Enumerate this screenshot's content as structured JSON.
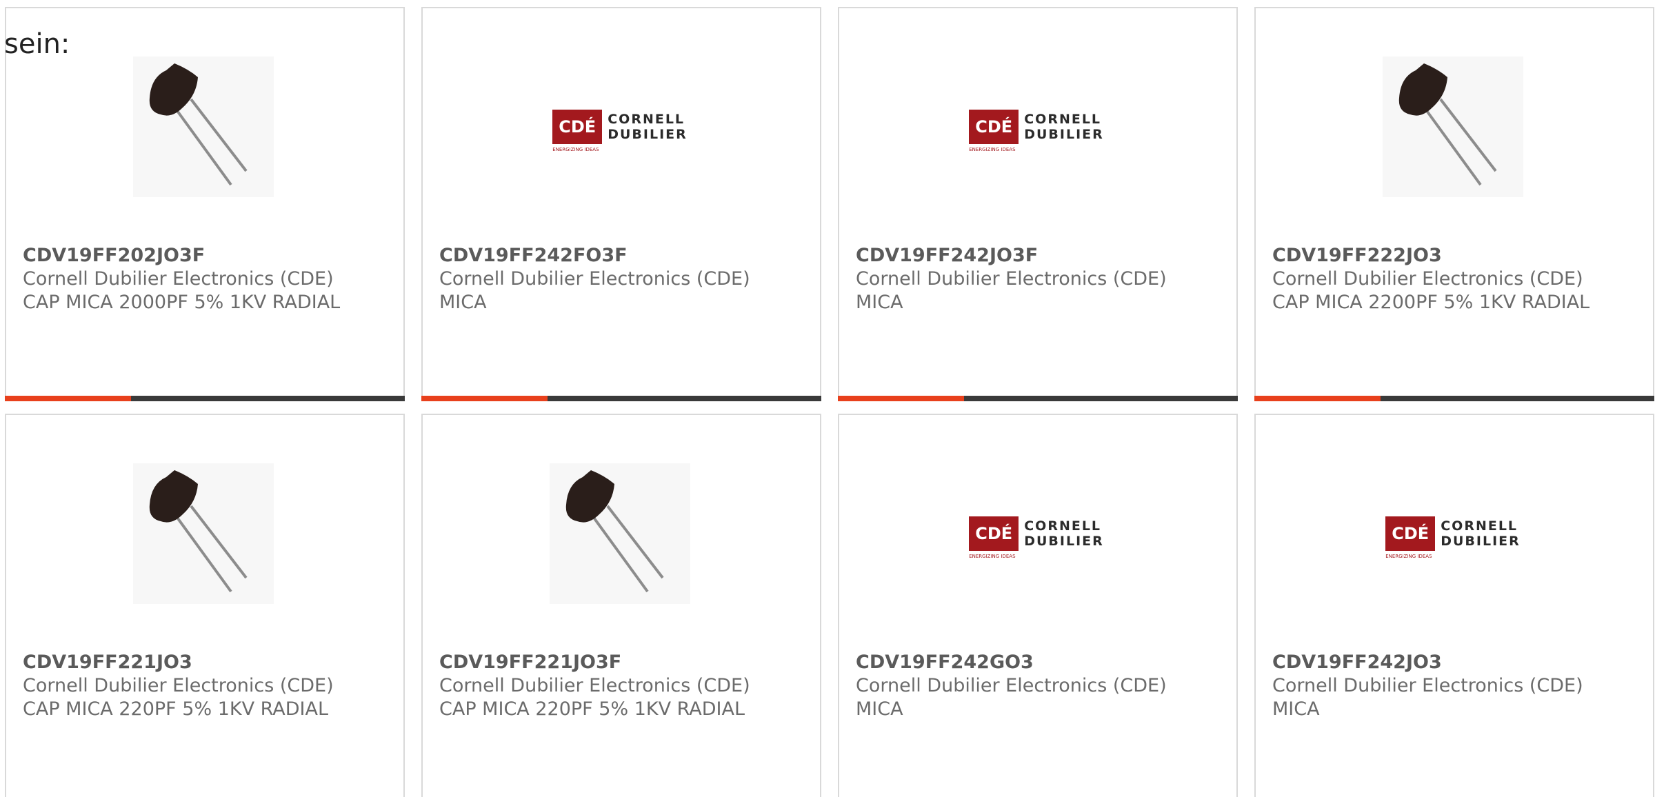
{
  "intro": {
    "text": "sein:"
  },
  "products": [
    {
      "part_number": "CDV19FF202JO3F",
      "manufacturer": "Cornell Dubilier Electronics (CDE)",
      "description": "CAP MICA 2000PF 5% 1KV RADIAL",
      "image": "capacitor-photo"
    },
    {
      "part_number": "CDV19FF242FO3F",
      "manufacturer": "Cornell Dubilier Electronics (CDE)",
      "description": "MICA",
      "image": "cde-logo"
    },
    {
      "part_number": "CDV19FF242JO3F",
      "manufacturer": "Cornell Dubilier Electronics (CDE)",
      "description": "MICA",
      "image": "cde-logo"
    },
    {
      "part_number": "CDV19FF222JO3",
      "manufacturer": "Cornell Dubilier Electronics (CDE)",
      "description": "CAP MICA 2200PF 5% 1KV RADIAL",
      "image": "capacitor-photo"
    },
    {
      "part_number": "CDV19FF221JO3",
      "manufacturer": "Cornell Dubilier Electronics (CDE)",
      "description": "CAP MICA 220PF 5% 1KV RADIAL",
      "image": "capacitor-photo"
    },
    {
      "part_number": "CDV19FF221JO3F",
      "manufacturer": "Cornell Dubilier Electronics (CDE)",
      "description": "CAP MICA 220PF 5% 1KV RADIAL",
      "image": "capacitor-photo"
    },
    {
      "part_number": "CDV19FF242GO3",
      "manufacturer": "Cornell Dubilier Electronics (CDE)",
      "description": "MICA",
      "image": "cde-logo"
    },
    {
      "part_number": "CDV19FF242JO3",
      "manufacturer": "Cornell Dubilier Electronics (CDE)",
      "description": "MICA",
      "image": "cde-logo"
    }
  ],
  "logo": {
    "badge_text": "CDÉ",
    "tagline": "ENERGIZING IDEAS",
    "line1": "CORNELL",
    "line2": "DUBILIER"
  },
  "colors": {
    "accent": "#e8401c",
    "bar": "#3a3a3a",
    "logo_red": "#a3191e",
    "text": "#6b6b6b"
  }
}
